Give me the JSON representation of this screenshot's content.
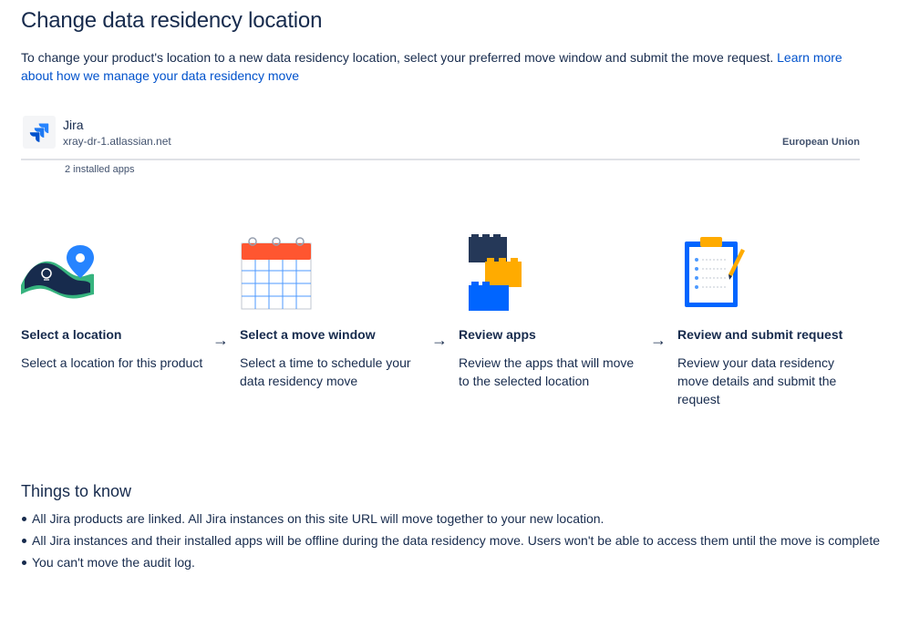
{
  "page": {
    "title": "Change data residency location",
    "intro_text": "To change your product's location to a new data residency location, select your preferred move window and submit the move request. ",
    "intro_link": "Learn more about how we manage your data residency move"
  },
  "product": {
    "name": "Jira",
    "url": "xray-dr-1.atlassian.net",
    "region": "European Union",
    "apps": "2 installed apps",
    "icon": "jira-logo-icon"
  },
  "steps": [
    {
      "title": "Select a location",
      "description": "Select a location for this product",
      "icon": "location-map-icon"
    },
    {
      "title": "Select a move window",
      "description": "Select a time to schedule your data residency move",
      "icon": "calendar-icon"
    },
    {
      "title": "Review apps",
      "description": "Review the apps that will move to the selected location",
      "icon": "blocks-icon"
    },
    {
      "title": "Review and submit request",
      "description": "Review your data residency move details and submit the request",
      "icon": "clipboard-icon"
    }
  ],
  "arrow_glyph": "→",
  "things_to_know": {
    "title": "Things to know",
    "items": [
      "All Jira products are linked. All Jira instances on this site URL will move together to your new location.",
      "All Jira instances and their installed apps will be offline during the data residency move. Users won't be able to access them until the move is complete",
      "You can't move the audit log."
    ]
  },
  "colors": {
    "text": "#172B4D",
    "link": "#0052CC",
    "divider": "#DFE1E6",
    "jira_blue": "#2684FF"
  }
}
